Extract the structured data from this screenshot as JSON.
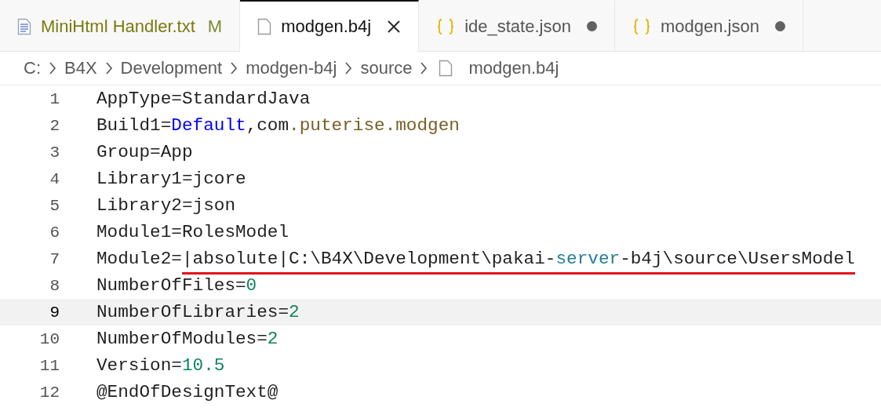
{
  "tabs": [
    {
      "label": "MiniHtml Handler.txt",
      "kind": "text",
      "git_status": "M",
      "selected": false,
      "dirty": false
    },
    {
      "label": "modgen.b4j",
      "kind": "file",
      "selected": true,
      "dirty": false
    },
    {
      "label": "ide_state.json",
      "kind": "json",
      "selected": false,
      "dirty": true
    },
    {
      "label": "modgen.json",
      "kind": "json",
      "selected": false,
      "dirty": true
    }
  ],
  "breadcrumb": [
    {
      "label": "C:",
      "kind": "folder"
    },
    {
      "label": "B4X",
      "kind": "folder"
    },
    {
      "label": "Development",
      "kind": "folder"
    },
    {
      "label": "modgen-b4j",
      "kind": "folder"
    },
    {
      "label": "source",
      "kind": "folder"
    },
    {
      "label": "modgen.b4j",
      "kind": "file"
    }
  ],
  "lines": [
    {
      "number": "1",
      "current": false,
      "tokens": [
        {
          "text": "AppType=StandardJava",
          "kind": "plain",
          "underlined": false
        }
      ]
    },
    {
      "number": "2",
      "current": false,
      "tokens": [
        {
          "text": "Build1=",
          "kind": "plain",
          "underlined": false
        },
        {
          "text": "Default",
          "kind": "keyword",
          "underlined": false
        },
        {
          "text": ",com",
          "kind": "plain",
          "underlined": false
        },
        {
          "text": ".puterise.modgen",
          "kind": "string",
          "underlined": false
        }
      ]
    },
    {
      "number": "3",
      "current": false,
      "tokens": [
        {
          "text": "Group=App",
          "kind": "plain",
          "underlined": false
        }
      ]
    },
    {
      "number": "4",
      "current": false,
      "tokens": [
        {
          "text": "Library1=jcore",
          "kind": "plain",
          "underlined": false
        }
      ]
    },
    {
      "number": "5",
      "current": false,
      "tokens": [
        {
          "text": "Library2=json",
          "kind": "plain",
          "underlined": false
        }
      ]
    },
    {
      "number": "6",
      "current": false,
      "tokens": [
        {
          "text": "Module1=RolesModel",
          "kind": "plain",
          "underlined": false
        }
      ]
    },
    {
      "number": "7",
      "current": false,
      "tokens": [
        {
          "text": "Module2=",
          "kind": "plain",
          "underlined": false
        },
        {
          "text": "|absolute|C:\\B4X\\Development\\pakai-",
          "kind": "plain",
          "underlined": true
        },
        {
          "text": "server",
          "kind": "type",
          "underlined": true
        },
        {
          "text": "-b4j\\source\\UsersModel",
          "kind": "plain",
          "underlined": true
        }
      ]
    },
    {
      "number": "8",
      "current": false,
      "tokens": [
        {
          "text": "NumberOfFiles=",
          "kind": "plain",
          "underlined": false
        },
        {
          "text": "0",
          "kind": "number",
          "underlined": false
        }
      ]
    },
    {
      "number": "9",
      "current": true,
      "tokens": [
        {
          "text": "NumberOfLibraries=",
          "kind": "plain",
          "underlined": false
        },
        {
          "text": "2",
          "kind": "number",
          "underlined": false
        }
      ]
    },
    {
      "number": "10",
      "current": false,
      "tokens": [
        {
          "text": "NumberOfModules=",
          "kind": "plain",
          "underlined": false
        },
        {
          "text": "2",
          "kind": "number",
          "underlined": false
        }
      ]
    },
    {
      "number": "11",
      "current": false,
      "tokens": [
        {
          "text": "Version=",
          "kind": "plain",
          "underlined": false
        },
        {
          "text": "10.5",
          "kind": "number",
          "underlined": false
        }
      ]
    },
    {
      "number": "12",
      "current": false,
      "tokens": [
        {
          "text": "@EndOfDesignText@",
          "kind": "plain",
          "underlined": false
        }
      ]
    }
  ]
}
